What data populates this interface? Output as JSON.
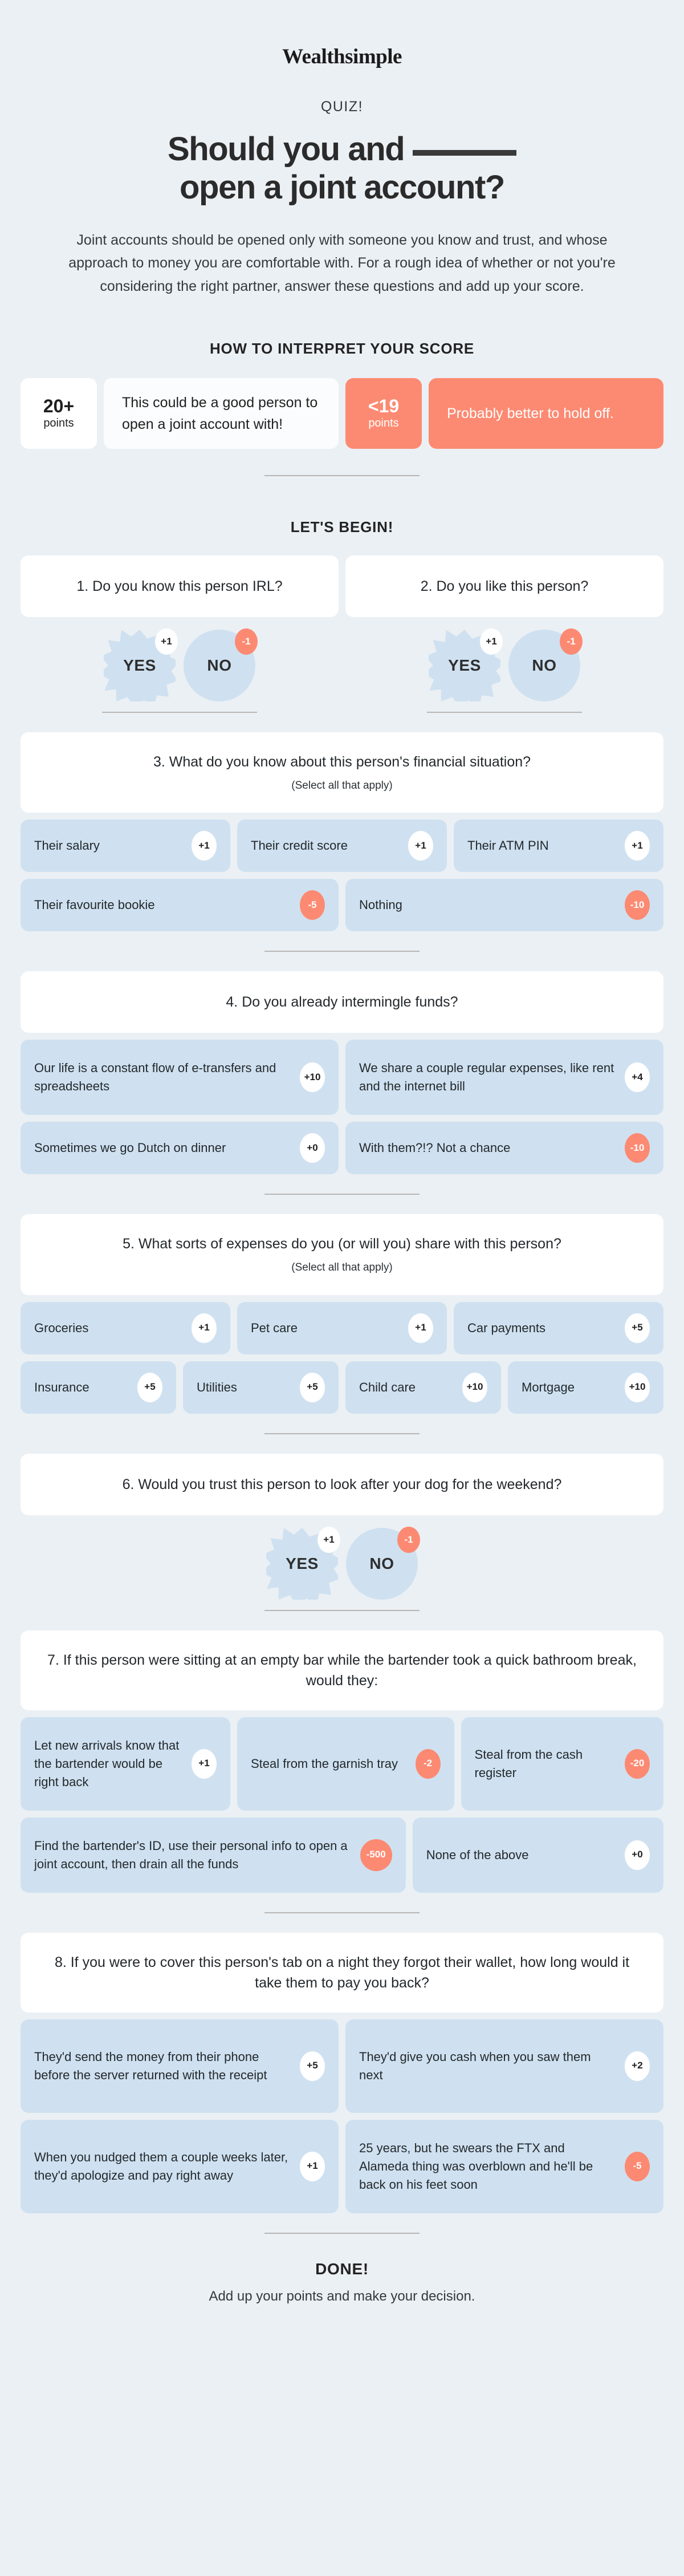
{
  "brand": "Wealthsimple",
  "kicker": "QUIZ!",
  "title": {
    "line1_before": "Should you and",
    "line2": "open a joint account?"
  },
  "intro": "Joint accounts should be opened only with someone you know and trust, and whose approach to money you are comfortable with. For a rough idea of whether or not you're considering the right partner, answer these questions and add up your score.",
  "score_section_heading": "HOW TO INTERPRET YOUR SCORE",
  "score_key": [
    {
      "threshold": "20+",
      "unit": "points",
      "description": "This could be a good person to open a joint account with!",
      "tone": "good",
      "pill_bg": "#ffffff",
      "desc_bg": "#fbfcfd"
    },
    {
      "threshold": "<19",
      "unit": "points",
      "description": "Probably better to hold off.",
      "tone": "bad",
      "pill_bg": "#fc8a72",
      "desc_bg": "#fc8a72"
    }
  ],
  "begin_heading": "LET'S BEGIN!",
  "yes_label": "YES",
  "no_label": "NO",
  "questions": [
    {
      "id": "q1",
      "text": "1. Do you know this person IRL?",
      "subtext": "",
      "type": "yes-no",
      "yes_points": "+1",
      "no_points": "-1"
    },
    {
      "id": "q2",
      "text": "2. Do you like this person?",
      "subtext": "",
      "type": "yes-no",
      "yes_points": "+1",
      "no_points": "-1"
    },
    {
      "id": "q3",
      "text": "3. What do you know about this person's financial situation?",
      "subtext": "(Select all that apply)",
      "type": "multi",
      "rows": [
        [
          {
            "label": "Their salary",
            "points": "+1",
            "tone": "pos"
          },
          {
            "label": "Their credit score",
            "points": "+1",
            "tone": "pos"
          },
          {
            "label": "Their ATM PIN",
            "points": "+1",
            "tone": "pos"
          }
        ],
        [
          {
            "label": "Their favourite bookie",
            "points": "-5",
            "tone": "neg"
          },
          {
            "label": "Nothing",
            "points": "-10",
            "tone": "neg"
          }
        ]
      ]
    },
    {
      "id": "q4",
      "text": "4. Do you already intermingle funds?",
      "subtext": "",
      "type": "single",
      "rows": [
        [
          {
            "label": "Our life is a constant flow of e-transfers and spreadsheets",
            "points": "+10",
            "tone": "pos"
          },
          {
            "label": "We share a couple regular expenses, like rent and the internet bill",
            "points": "+4",
            "tone": "pos"
          }
        ],
        [
          {
            "label": "Sometimes we go Dutch on dinner",
            "points": "+0",
            "tone": "pos"
          },
          {
            "label": "With them?!? Not a chance",
            "points": "-10",
            "tone": "neg"
          }
        ]
      ]
    },
    {
      "id": "q5",
      "text": "5. What sorts of expenses do you (or will you) share with this person?",
      "subtext": "(Select all that apply)",
      "type": "multi",
      "rows": [
        [
          {
            "label": "Groceries",
            "points": "+1",
            "tone": "pos"
          },
          {
            "label": "Pet care",
            "points": "+1",
            "tone": "pos"
          },
          {
            "label": "Car payments",
            "points": "+5",
            "tone": "pos"
          }
        ],
        [
          {
            "label": "Insurance",
            "points": "+5",
            "tone": "pos"
          },
          {
            "label": "Utilities",
            "points": "+5",
            "tone": "pos"
          },
          {
            "label": "Child care",
            "points": "+10",
            "tone": "pos"
          },
          {
            "label": "Mortgage",
            "points": "+10",
            "tone": "pos"
          }
        ]
      ]
    },
    {
      "id": "q6",
      "text": "6. Would you trust this person to look after your dog for the weekend?",
      "subtext": "",
      "type": "yes-no",
      "yes_points": "+1",
      "no_points": "-1"
    },
    {
      "id": "q7",
      "text": "7. If this person were sitting at an empty bar while the bartender took a quick bathroom break, would they:",
      "subtext": "",
      "type": "single",
      "rows": [
        [
          {
            "label": "Let new arrivals know that the bartender would be right back",
            "points": "+1",
            "tone": "pos"
          },
          {
            "label": "Steal from the garnish tray",
            "points": "-2",
            "tone": "neg"
          },
          {
            "label": "Steal from the cash register",
            "points": "-20",
            "tone": "neg"
          }
        ],
        [
          {
            "label": "Find the bartender's ID, use their personal info to open a joint account, then drain all the funds",
            "points": "-500",
            "tone": "neg"
          },
          {
            "label": "None of the above",
            "points": "+0",
            "tone": "pos"
          }
        ]
      ]
    },
    {
      "id": "q8",
      "text": "8. If you were to cover this person's tab on a night they forgot their wallet, how long would it take them to pay you back?",
      "subtext": "",
      "type": "single",
      "rows": [
        [
          {
            "label": "They'd send the money from their phone before the server returned with the receipt",
            "points": "+5",
            "tone": "pos"
          },
          {
            "label": "They'd give you cash when you saw them next",
            "points": "+2",
            "tone": "pos"
          }
        ],
        [
          {
            "label": "When you nudged them a couple weeks later, they'd apologize and pay right away",
            "points": "+1",
            "tone": "pos"
          },
          {
            "label": "25 years, but he swears the FTX and Alameda thing was overblown and he'll be back on his feet soon",
            "points": "-5",
            "tone": "neg"
          }
        ]
      ]
    }
  ],
  "footer": {
    "heading": "DONE!",
    "subtext": "Add up your points and make your decision."
  },
  "colors": {
    "background": "#ebf0f4",
    "card_white": "#ffffff",
    "option_blue": "#cfe1f0",
    "accent_coral": "#fc8a72",
    "text_dark": "#2e2e2e",
    "divider": "#b9b6b4"
  }
}
